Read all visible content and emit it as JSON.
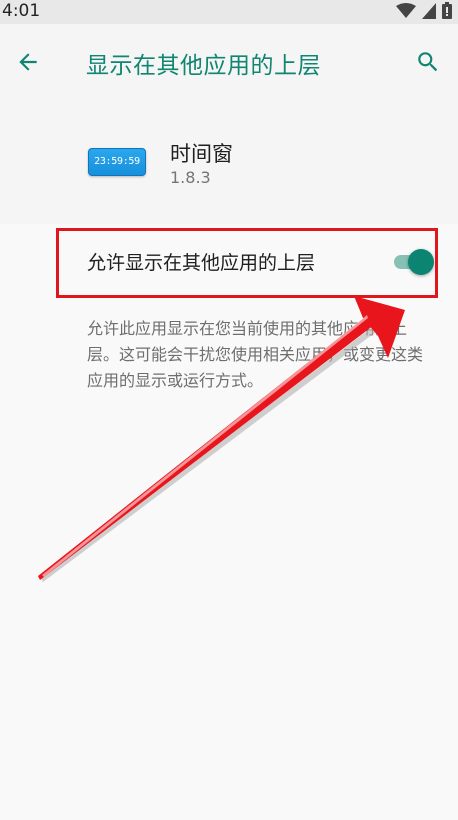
{
  "status_bar": {
    "time": "4:01",
    "icons": [
      "wifi-icon",
      "signal-icon",
      "battery-icon"
    ]
  },
  "app_bar": {
    "title": "显示在其他应用的上层",
    "back_icon": "arrow-back-icon",
    "search_icon": "search-icon"
  },
  "app_info": {
    "icon_text": "23:59:59",
    "name": "时间窗",
    "version": "1.8.3"
  },
  "permission": {
    "label": "允许显示在其他应用的上层",
    "enabled": true,
    "description": "允许此应用显示在您当前使用的其他应用的上层。这可能会干扰您使用相关应用，或变更这类应用的显示或运行方式。"
  },
  "colors": {
    "accent": "#108571",
    "toggle_thumb": "#0c8472",
    "toggle_track": "#86c1b6",
    "highlight": "#e0161e"
  }
}
